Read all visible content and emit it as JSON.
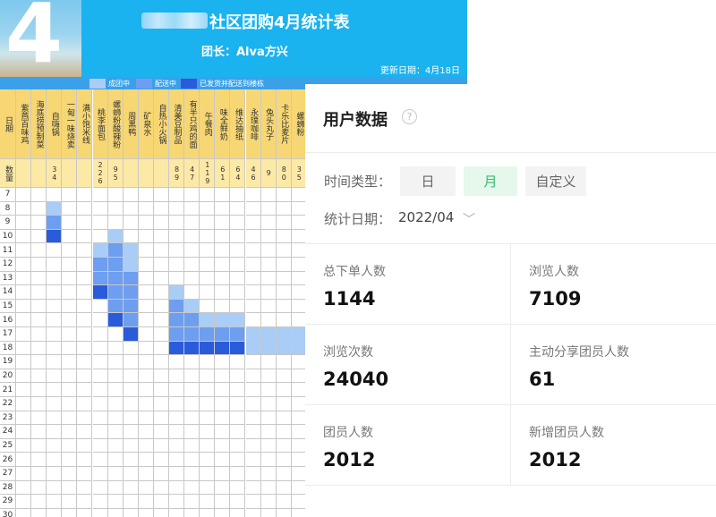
{
  "sheet": {
    "month": "4",
    "title": "社区团购4月统计表",
    "leader": "团长：Alva方兴",
    "update": "更新日期：4月18日",
    "legend": [
      {
        "label": "成团中",
        "color": "#a9cdf6"
      },
      {
        "label": "配送中",
        "color": "#6d9ef0"
      },
      {
        "label": "已发货并配送到楼栋",
        "color": "#2a5bdb"
      }
    ],
    "date_header": "日期",
    "qty_header": "数量",
    "products": [
      {
        "name": "紫燕百味鸡",
        "qty": ""
      },
      {
        "name": "海底捞预制菜",
        "qty": ""
      },
      {
        "name": "自嗨锅",
        "qty": "34"
      },
      {
        "name": "一甸一味烧卖",
        "qty": ""
      },
      {
        "name": "满小饱米线",
        "qty": ""
      },
      {
        "name": "桃李面包",
        "qty": "226"
      },
      {
        "name": "螺蛳粉酸辣粉",
        "qty": "95"
      },
      {
        "name": "周黑鸭",
        "qty": ""
      },
      {
        "name": "矿泉水",
        "qty": ""
      },
      {
        "name": "自热小火锅",
        "qty": ""
      },
      {
        "name": "清美豆制品",
        "qty": "89"
      },
      {
        "name": "有半只鸡的面",
        "qty": "47"
      },
      {
        "name": "午餐肉",
        "qty": "119"
      },
      {
        "name": "味全鲜奶",
        "qty": "61"
      },
      {
        "name": "维达抽纸",
        "qty": "64"
      },
      {
        "name": "永璞咖啡",
        "qty": "46"
      },
      {
        "name": "兔头丸子",
        "qty": "9"
      },
      {
        "name": "卡乐比麦片",
        "qty": "80"
      },
      {
        "name": "螺蛳粉",
        "qty": "35"
      }
    ],
    "days": [
      "7",
      "8",
      "9",
      "10",
      "11",
      "12",
      "13",
      "14",
      "15",
      "16",
      "17",
      "18",
      "19",
      "20",
      "21",
      "22",
      "23",
      "24",
      "25",
      "26",
      "27",
      "28",
      "29",
      "30"
    ],
    "status_cells": [
      {
        "day": "8",
        "col": 2,
        "s": 1
      },
      {
        "day": "9",
        "col": 2,
        "s": 2
      },
      {
        "day": "10",
        "col": 2,
        "s": 3
      },
      {
        "day": "10",
        "col": 6,
        "s": 1
      },
      {
        "day": "11",
        "col": 5,
        "s": 1
      },
      {
        "day": "11",
        "col": 6,
        "s": 2
      },
      {
        "day": "11",
        "col": 7,
        "s": 1
      },
      {
        "day": "12",
        "col": 5,
        "s": 2
      },
      {
        "day": "12",
        "col": 6,
        "s": 2
      },
      {
        "day": "12",
        "col": 7,
        "s": 1
      },
      {
        "day": "13",
        "col": 5,
        "s": 2
      },
      {
        "day": "13",
        "col": 6,
        "s": 2
      },
      {
        "day": "13",
        "col": 7,
        "s": 2
      },
      {
        "day": "14",
        "col": 5,
        "s": 3
      },
      {
        "day": "14",
        "col": 6,
        "s": 2
      },
      {
        "day": "14",
        "col": 7,
        "s": 2
      },
      {
        "day": "14",
        "col": 10,
        "s": 1
      },
      {
        "day": "15",
        "col": 6,
        "s": 2
      },
      {
        "day": "15",
        "col": 7,
        "s": 2
      },
      {
        "day": "15",
        "col": 10,
        "s": 2
      },
      {
        "day": "15",
        "col": 11,
        "s": 1
      },
      {
        "day": "16",
        "col": 6,
        "s": 3
      },
      {
        "day": "16",
        "col": 7,
        "s": 2
      },
      {
        "day": "16",
        "col": 10,
        "s": 2
      },
      {
        "day": "16",
        "col": 11,
        "s": 2
      },
      {
        "day": "16",
        "col": 12,
        "s": 1
      },
      {
        "day": "16",
        "col": 13,
        "s": 1
      },
      {
        "day": "16",
        "col": 14,
        "s": 1
      },
      {
        "day": "17",
        "col": 7,
        "s": 3
      },
      {
        "day": "17",
        "col": 10,
        "s": 2
      },
      {
        "day": "17",
        "col": 11,
        "s": 2
      },
      {
        "day": "17",
        "col": 12,
        "s": 2
      },
      {
        "day": "17",
        "col": 13,
        "s": 2
      },
      {
        "day": "17",
        "col": 14,
        "s": 2
      },
      {
        "day": "17",
        "col": 15,
        "s": 1
      },
      {
        "day": "17",
        "col": 16,
        "s": 1
      },
      {
        "day": "17",
        "col": 17,
        "s": 1
      },
      {
        "day": "17",
        "col": 18,
        "s": 1
      },
      {
        "day": "18",
        "col": 10,
        "s": 3
      },
      {
        "day": "18",
        "col": 11,
        "s": 3
      },
      {
        "day": "18",
        "col": 12,
        "s": 3
      },
      {
        "day": "18",
        "col": 13,
        "s": 3
      },
      {
        "day": "18",
        "col": 14,
        "s": 3
      },
      {
        "day": "18",
        "col": 15,
        "s": 1
      },
      {
        "day": "18",
        "col": 16,
        "s": 1
      },
      {
        "day": "18",
        "col": 17,
        "s": 1
      },
      {
        "day": "18",
        "col": 18,
        "s": 1
      }
    ],
    "status_colors": [
      "#ffffff",
      "#a9cdf6",
      "#6d9ef0",
      "#2a5bdb"
    ]
  },
  "panel": {
    "title": "用户数据",
    "help_icon": "question-circle-icon",
    "help_glyph": "?",
    "time_type_label": "时间类型：",
    "time_types": [
      "日",
      "月",
      "自定义"
    ],
    "time_type_selected": "月",
    "date_label": "统计日期：",
    "date_value": "2022/04",
    "chevron_glyph": "﹀",
    "stats": [
      {
        "label": "总下单人数",
        "value": "1144"
      },
      {
        "label": "浏览人数",
        "value": "7109"
      },
      {
        "label": "浏览次数",
        "value": "24040"
      },
      {
        "label": "主动分享团员人数",
        "value": "61"
      },
      {
        "label": "团员人数",
        "value": "2012"
      },
      {
        "label": "新增团员人数",
        "value": "2012"
      }
    ]
  }
}
